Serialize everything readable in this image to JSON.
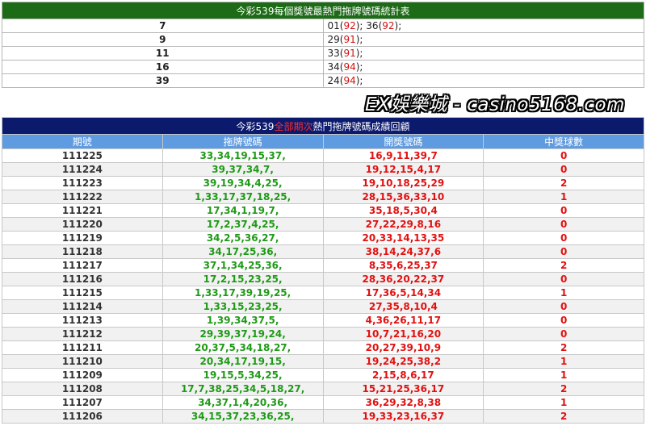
{
  "top": {
    "title": "今彩539每個獎號最熱門拖牌號碼統計表",
    "rows": [
      {
        "num": "7",
        "items": [
          {
            "n": "01",
            "c": "92"
          },
          {
            "n": "36",
            "c": "92"
          }
        ]
      },
      {
        "num": "9",
        "items": [
          {
            "n": "29",
            "c": "91"
          }
        ]
      },
      {
        "num": "11",
        "items": [
          {
            "n": "33",
            "c": "91"
          }
        ]
      },
      {
        "num": "16",
        "items": [
          {
            "n": "34",
            "c": "94"
          }
        ]
      },
      {
        "num": "39",
        "items": [
          {
            "n": "24",
            "c": "94"
          }
        ]
      }
    ]
  },
  "watermark": "EX娛樂城 - casino5168.com",
  "main": {
    "title_prefix": "今彩539",
    "title_highlight": "全部期次",
    "title_suffix": "熱門拖牌號碼成績回顧",
    "headers": [
      "期號",
      "拖牌號碼",
      "開獎號碼",
      "中獎球數"
    ],
    "rows": [
      {
        "period": "111225",
        "drag": "33,34,19,15,37,",
        "draw": "16,9,11,39,7",
        "hits": "0"
      },
      {
        "period": "111224",
        "drag": "39,37,34,7,",
        "draw": "19,12,15,4,17",
        "hits": "0"
      },
      {
        "period": "111223",
        "drag": "39,19,34,4,25,",
        "draw": "19,10,18,25,29",
        "hits": "2"
      },
      {
        "period": "111222",
        "drag": "1,33,17,37,18,25,",
        "draw": "28,15,36,33,10",
        "hits": "1"
      },
      {
        "period": "111221",
        "drag": "17,34,1,19,7,",
        "draw": "35,18,5,30,4",
        "hits": "0"
      },
      {
        "period": "111220",
        "drag": "17,2,37,4,25,",
        "draw": "27,22,29,8,16",
        "hits": "0"
      },
      {
        "period": "111219",
        "drag": "34,2,5,36,27,",
        "draw": "20,33,14,13,35",
        "hits": "0"
      },
      {
        "period": "111218",
        "drag": "34,17,25,36,",
        "draw": "38,14,24,37,6",
        "hits": "0"
      },
      {
        "period": "111217",
        "drag": "37,1,34,25,36,",
        "draw": "8,35,6,25,37",
        "hits": "2"
      },
      {
        "period": "111216",
        "drag": "17,2,15,23,25,",
        "draw": "28,36,20,22,37",
        "hits": "0"
      },
      {
        "period": "111215",
        "drag": "1,33,17,39,19,25,",
        "draw": "17,36,5,14,34",
        "hits": "1"
      },
      {
        "period": "111214",
        "drag": "1,33,15,23,25,",
        "draw": "27,35,8,10,4",
        "hits": "0"
      },
      {
        "period": "111213",
        "drag": "1,39,34,37,5,",
        "draw": "4,36,26,11,17",
        "hits": "0"
      },
      {
        "period": "111212",
        "drag": "29,39,37,19,24,",
        "draw": "10,7,21,16,20",
        "hits": "0"
      },
      {
        "period": "111211",
        "drag": "20,37,5,34,18,27,",
        "draw": "20,27,39,10,9",
        "hits": "2"
      },
      {
        "period": "111210",
        "drag": "20,34,17,19,15,",
        "draw": "19,24,25,38,2",
        "hits": "1"
      },
      {
        "period": "111209",
        "drag": "19,15,5,34,25,",
        "draw": "2,15,8,6,17",
        "hits": "1"
      },
      {
        "period": "111208",
        "drag": "17,7,38,25,34,5,18,27,",
        "draw": "15,21,25,36,17",
        "hits": "2"
      },
      {
        "period": "111207",
        "drag": "34,37,1,4,20,36,",
        "draw": "36,29,32,8,38",
        "hits": "1"
      },
      {
        "period": "111206",
        "drag": "34,15,37,23,36,25,",
        "draw": "19,33,23,16,37",
        "hits": "2"
      }
    ]
  }
}
